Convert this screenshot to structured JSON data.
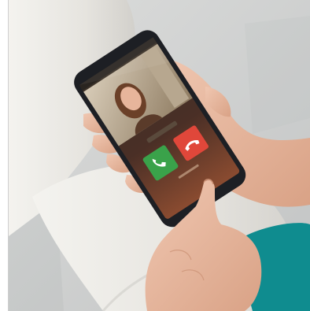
{
  "scene": {
    "description_free": true,
    "colors": {
      "background_white": "#ffffff",
      "floor_gray": "#cfd0d0",
      "trousers": "#e9e8e4",
      "skin": "#e9b9a1",
      "sleeve_teal": "#0f8c8f",
      "phone_body": "#1d1f24",
      "screen_dark": "#2b2620",
      "accept_green": "#3aa24a",
      "decline_red": "#e0473a"
    },
    "icons": [
      "phone-accept-icon",
      "phone-decline-icon"
    ]
  }
}
